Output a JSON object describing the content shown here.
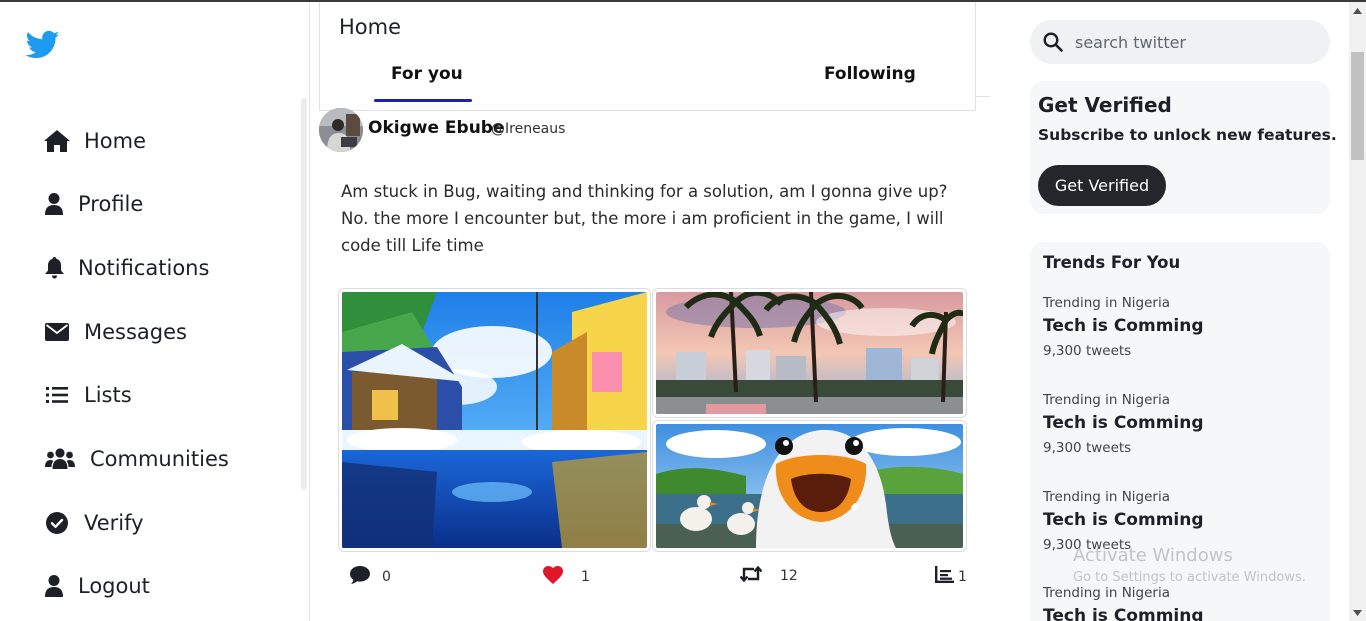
{
  "app": {
    "logo_icon": "twitter-bird-icon",
    "brand_color": "#1d9bf0"
  },
  "sidebar": {
    "items": [
      {
        "label": "Home",
        "icon": "home-icon"
      },
      {
        "label": "Profile",
        "icon": "user-icon"
      },
      {
        "label": "Notifications",
        "icon": "bell-icon"
      },
      {
        "label": "Messages",
        "icon": "envelope-icon"
      },
      {
        "label": "Lists",
        "icon": "list-icon"
      },
      {
        "label": "Communities",
        "icon": "users-icon"
      },
      {
        "label": "Verify",
        "icon": "check-circle-icon"
      },
      {
        "label": "Logout",
        "icon": "user-icon"
      }
    ]
  },
  "main": {
    "title": "Home",
    "tabs": [
      {
        "label": "For you",
        "active": true
      },
      {
        "label": "Following",
        "active": false
      }
    ],
    "tab_underline_color": "#1d1fb9"
  },
  "post": {
    "name": "Okigwe Ebube",
    "handle": "@Ireneaus",
    "text": "Am stuck in Bug, waiting and thinking for a solution, am I gonna give up? No. the more I encounter but, the more i am proficient in the game, I will code till Life time",
    "actions": {
      "comments": "0",
      "likes": "1",
      "retweets": "12",
      "stats": "1"
    },
    "like_color": "#e0162b"
  },
  "search": {
    "placeholder": "search twitter",
    "value": ""
  },
  "verify": {
    "title": "Get Verified",
    "subtitle": "Subscribe to unlock new features.",
    "button_label": "Get Verified"
  },
  "trends": {
    "title": "Trends For You",
    "items": [
      {
        "location": "Trending in Nigeria",
        "topic": "Tech is Comming",
        "count": "9,300 tweets"
      },
      {
        "location": "Trending in Nigeria",
        "topic": "Tech is Comming",
        "count": "9,300 tweets"
      },
      {
        "location": "Trending in Nigeria",
        "topic": "Tech is Comming",
        "count": "9,300 tweets"
      },
      {
        "location": "Trending in Nigeria",
        "topic": "Tech is Comming"
      }
    ]
  },
  "watermark": {
    "title": "Activate Windows",
    "subtitle": "Go to Settings to activate Windows."
  }
}
